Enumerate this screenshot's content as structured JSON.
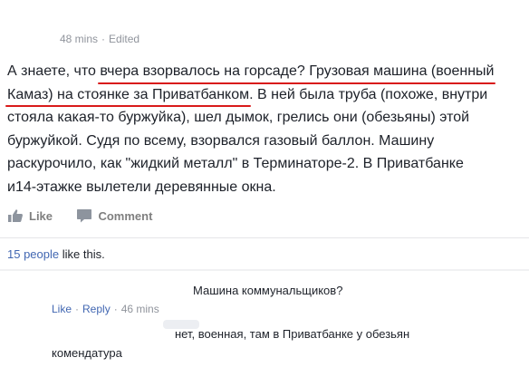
{
  "post": {
    "time": "48 mins",
    "separator": "·",
    "edited": "Edited",
    "text": {
      "l1_a": "А знаете, что ",
      "l1_hl": "вчера взорвалось на горсаде? Грузовая машина (военный",
      "l2_hl": "Камаз) на стоянке за Приватбанком",
      "l2_b": ". В ней была труба (похоже, внутри",
      "l3": "стояла какая-то буржуйка), шел дымок, грелись они (обезьяны) этой",
      "l4": "буржуйкой. Судя по всему, взорвался газовый баллон. Машину",
      "l5": "раскурочило, как \"жидкий металл\" в Терминаторе-2. В Приватбанке",
      "l6": "и14-этажке вылетели деревянные окна."
    },
    "accent_color": "#d91a1a"
  },
  "actions": {
    "like_label": "Like",
    "comment_label": "Comment"
  },
  "likes": {
    "count_link": "15 people",
    "suffix": " like this."
  },
  "comments": [
    {
      "text": "Машина коммунальщиков?",
      "like_label": "Like",
      "reply_label": "Reply",
      "separator": "·",
      "time": "46 mins"
    },
    {
      "text_line1": "нет, военная, там в Приватбанке у обезьян",
      "text_line2": "комендатура"
    }
  ],
  "colors": {
    "link": "#4267b2",
    "muted": "#90949c",
    "text": "#1d2129"
  }
}
